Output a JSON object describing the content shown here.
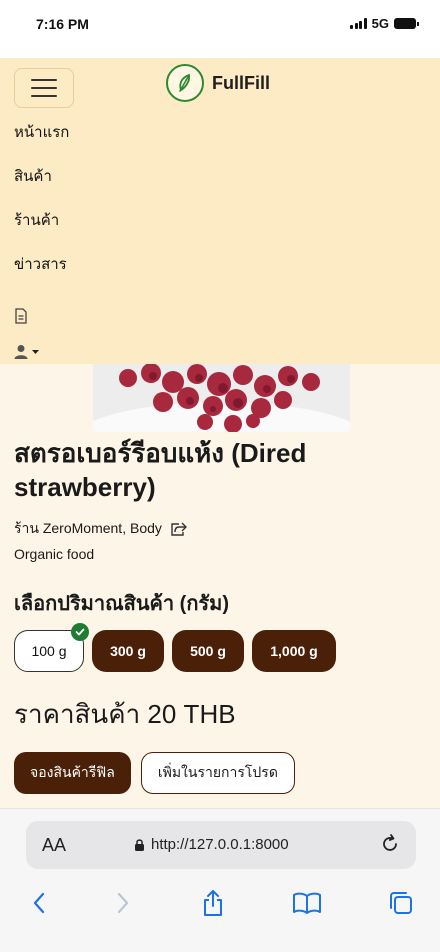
{
  "status_bar": {
    "time": "7:16 PM",
    "network": "5G"
  },
  "nav": {
    "brand": "FullFill",
    "menu": [
      "หน้าแรก",
      "สินค้า",
      "ร้านค้า",
      "ข่าวสาร"
    ]
  },
  "product": {
    "title": "สตรอเบอร์รีอบแห้ง (Dired strawberry)",
    "shop": "ร้าน ZeroMoment, Body",
    "category": "Organic food",
    "quantity_heading": "เลือกปริมาณสินค้า (กรัม)",
    "quantities": [
      "100 g",
      "300 g",
      "500 g",
      "1,000 g"
    ],
    "selected_quantity": "100 g",
    "price": "ราคาสินค้า 20 THB",
    "reserve_button": "จองสินค้ารีฟิล",
    "wishlist_button": "เพิ่มในรายการโปรด"
  },
  "browser": {
    "text_size_label": "AA",
    "url": "http://127.0.0.1:8000"
  },
  "colors": {
    "nav_bg": "#fdebc6",
    "content_bg": "#fdf6e8",
    "accent_brown": "#4a2008",
    "check_green": "#1e7d32",
    "logo_green": "#2c8a2e"
  }
}
